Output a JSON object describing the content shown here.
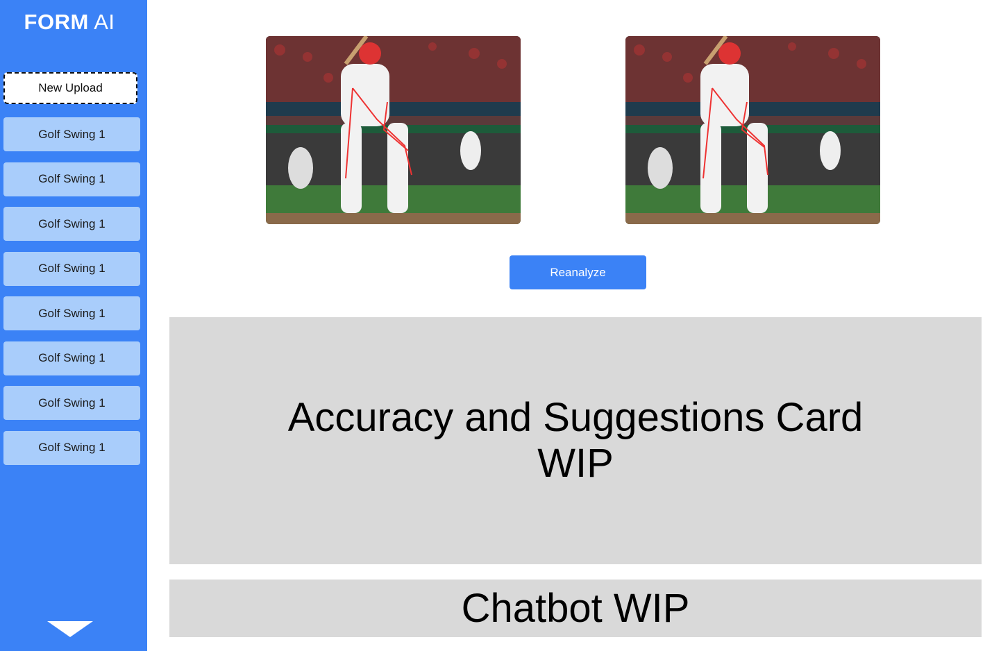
{
  "brand": {
    "bold": "FORM",
    "light": "AI"
  },
  "sidebar": {
    "new_upload_label": "New Upload",
    "items": [
      {
        "label": "Golf Swing 1"
      },
      {
        "label": "Golf Swing 1"
      },
      {
        "label": "Golf Swing 1"
      },
      {
        "label": "Golf Swing 1"
      },
      {
        "label": "Golf Swing 1"
      },
      {
        "label": "Golf Swing 1"
      },
      {
        "label": "Golf Swing 1"
      },
      {
        "label": "Golf Swing 1"
      }
    ],
    "scroll_icon": "chevron-down-icon"
  },
  "main": {
    "reanalyze_label": "Reanalyze",
    "card_title": "Accuracy and Suggestions Card WIP",
    "chatbot_title": "Chatbot WIP"
  },
  "colors": {
    "accent": "#3b82f6",
    "sidebar_item": "#a9cdfb",
    "card_bg": "#d9d9d9"
  }
}
